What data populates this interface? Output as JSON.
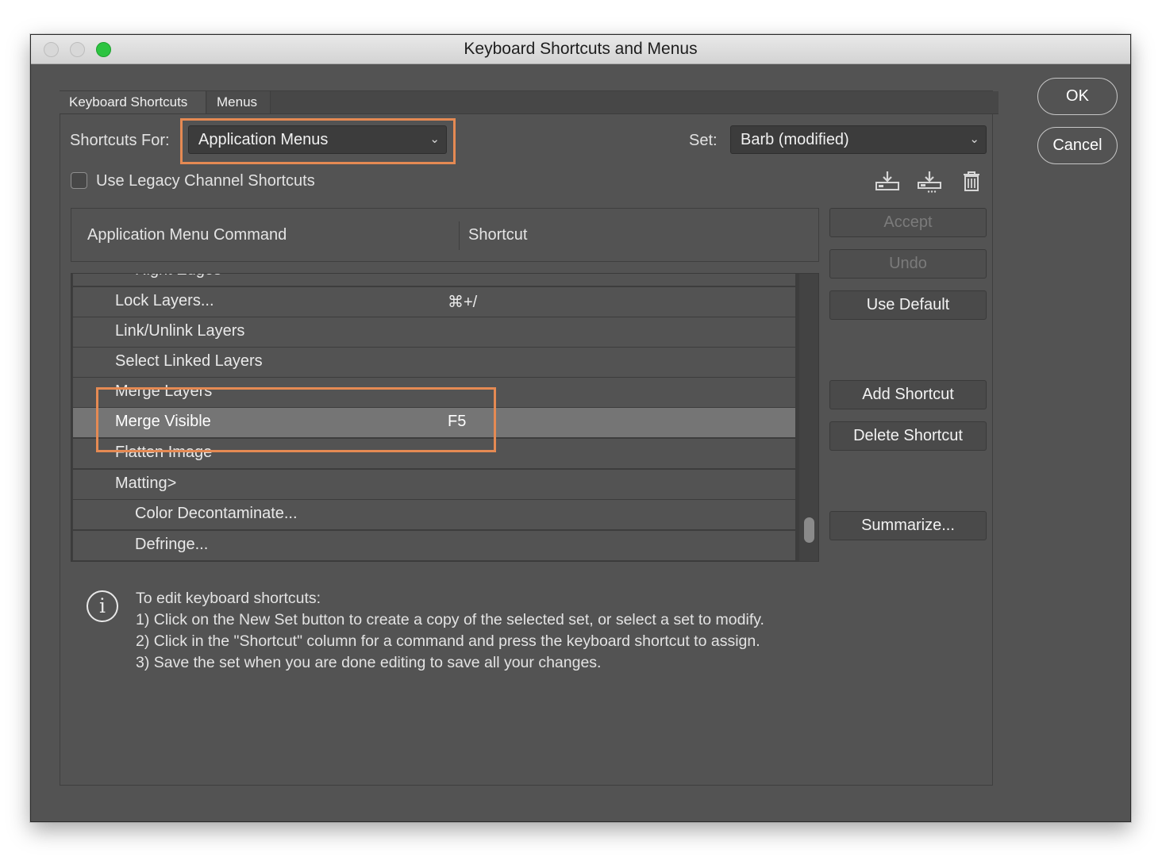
{
  "window": {
    "title": "Keyboard Shortcuts and Menus"
  },
  "tabs": [
    "Keyboard Shortcuts",
    "Menus"
  ],
  "shortcuts_for": {
    "label": "Shortcuts For:",
    "value": "Application Menus"
  },
  "set": {
    "label": "Set:",
    "value": "Barb (modified)"
  },
  "legacy_checkbox": {
    "label": "Use Legacy Channel Shortcuts",
    "checked": false
  },
  "icons": [
    "save-set-icon",
    "new-set-icon",
    "delete-set-icon"
  ],
  "table": {
    "col_command": "Application Menu Command",
    "col_shortcut": "Shortcut",
    "rows": [
      {
        "command": "Right Edges",
        "shortcut": ""
      },
      {
        "command": "Lock Layers...",
        "shortcut": "⌘+/"
      },
      {
        "command": "Link/Unlink Layers",
        "shortcut": ""
      },
      {
        "command": "Select Linked Layers",
        "shortcut": ""
      },
      {
        "command": "Merge Layers",
        "shortcut": ""
      },
      {
        "command": "Merge Visible",
        "shortcut": "F5",
        "selected": true
      },
      {
        "command": "Flatten Image",
        "shortcut": ""
      },
      {
        "command": "Matting>",
        "shortcut": ""
      },
      {
        "command": "Color Decontaminate...",
        "shortcut": ""
      },
      {
        "command": "Defringe...",
        "shortcut": ""
      }
    ]
  },
  "side_buttons": {
    "accept": "Accept",
    "undo": "Undo",
    "use_default": "Use Default",
    "add_shortcut": "Add Shortcut",
    "delete_shortcut": "Delete Shortcut",
    "summarize": "Summarize..."
  },
  "dialog_buttons": {
    "ok": "OK",
    "cancel": "Cancel"
  },
  "info": {
    "line1": "To edit keyboard shortcuts:",
    "line2": "1) Click on the New Set button to create a copy of the selected set, or select a set to modify.",
    "line3": "2) Click in the \"Shortcut\" column for a command and press the keyboard shortcut to assign.",
    "line4": "3) Save the set when you are done editing to save all your changes."
  },
  "colors": {
    "highlight": "#e58a53",
    "window_bg": "#535353",
    "zoom_button": "#2dc441"
  }
}
